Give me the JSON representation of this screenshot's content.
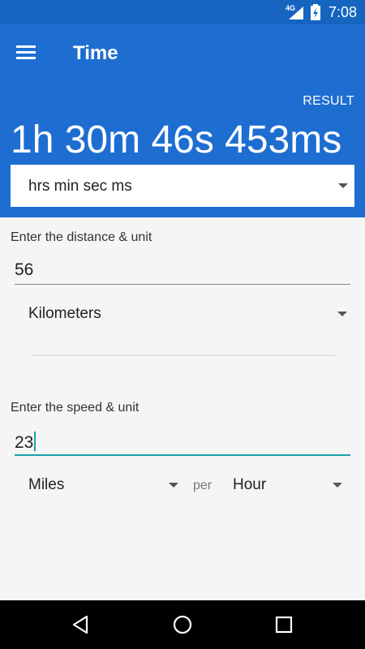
{
  "status_bar": {
    "network": "4G",
    "time": "7:08"
  },
  "app_bar": {
    "title": "Time",
    "result_label": "RESULT",
    "result_value": "1h 30m 46s 453ms",
    "format": "hrs min sec ms"
  },
  "distance": {
    "label": "Enter the distance & unit",
    "value": "56",
    "unit": "Kilometers"
  },
  "speed": {
    "label": "Enter the speed & unit",
    "value": "23",
    "unit": "Miles",
    "per_label": "per",
    "time_unit": "Hour"
  },
  "colors": {
    "primary": "#1e6ed1",
    "status_bar": "#1565c0",
    "accent": "#1aa0a8"
  },
  "icons": [
    "menu-icon",
    "signal-icon",
    "battery-icon",
    "back-icon",
    "home-icon",
    "recents-icon",
    "dropdown-arrow-icon"
  ]
}
